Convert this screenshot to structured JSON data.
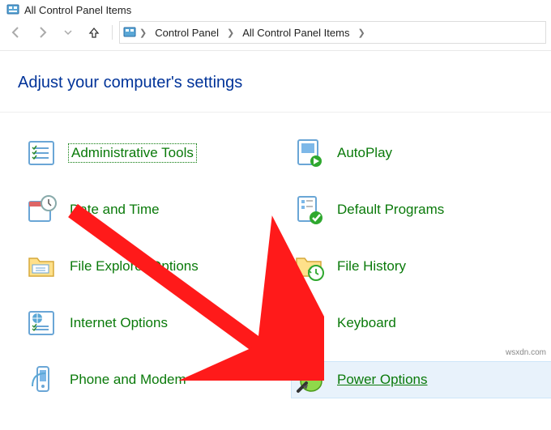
{
  "window": {
    "title": "All Control Panel Items"
  },
  "breadcrumb": {
    "items": [
      "Control Panel",
      "All Control Panel Items"
    ]
  },
  "heading": "Adjust your computer's settings",
  "items": {
    "admin_tools": {
      "label": "Administrative Tools"
    },
    "autoplay": {
      "label": "AutoPlay"
    },
    "date_time": {
      "label": "Date and Time"
    },
    "default_prog": {
      "label": "Default Programs"
    },
    "file_explorer": {
      "label": "File Explorer Options"
    },
    "file_history": {
      "label": "File History"
    },
    "internet": {
      "label": "Internet Options"
    },
    "keyboard": {
      "label": "Keyboard"
    },
    "phone_modem": {
      "label": "Phone and Modem"
    },
    "power": {
      "label": "Power Options"
    }
  },
  "watermark": "wsxdn.com"
}
